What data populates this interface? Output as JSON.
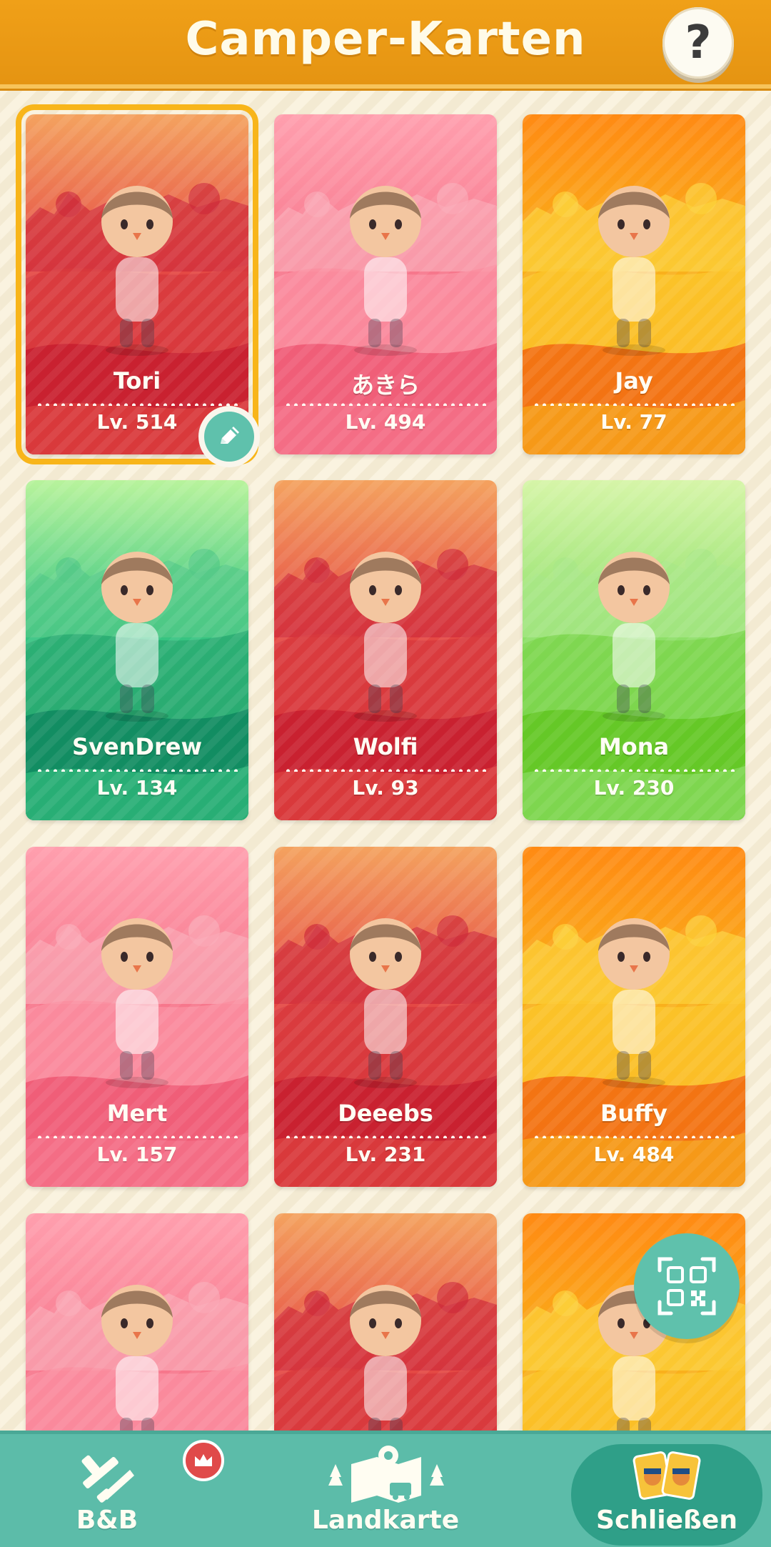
{
  "header": {
    "title": "Camper-Karten",
    "help_label": "?"
  },
  "cards": [
    {
      "name": "Tori",
      "level": "Lv. 514",
      "theme": "red",
      "selected": true
    },
    {
      "name": "あきら",
      "level": "Lv. 494",
      "theme": "pink",
      "selected": false
    },
    {
      "name": "Jay",
      "level": "Lv. 77",
      "theme": "orange",
      "selected": false
    },
    {
      "name": "SvenDrew",
      "level": "Lv. 134",
      "theme": "green",
      "selected": false
    },
    {
      "name": "Wolfi",
      "level": "Lv. 93",
      "theme": "red",
      "selected": false
    },
    {
      "name": "Mona",
      "level": "Lv. 230",
      "theme": "lime",
      "selected": false
    },
    {
      "name": "Mert",
      "level": "Lv. 157",
      "theme": "pink",
      "selected": false
    },
    {
      "name": "Deeebs",
      "level": "Lv. 231",
      "theme": "red",
      "selected": false
    },
    {
      "name": "Buffy",
      "level": "Lv. 484",
      "theme": "orange",
      "selected": false
    },
    {
      "name": "",
      "level": "",
      "theme": "pink",
      "selected": false
    },
    {
      "name": "",
      "level": "",
      "theme": "red",
      "selected": false
    },
    {
      "name": "",
      "level": "",
      "theme": "orange",
      "selected": false
    }
  ],
  "icons": {
    "edit": "pencil-icon",
    "qr": "qr-code-icon",
    "help": "question-mark-icon",
    "bnb": "hammer-saw-icon",
    "map": "map-icon",
    "close": "cards-icon",
    "crown": "crown-icon"
  },
  "bottom_nav": {
    "bnb_label": "B&B",
    "map_label": "Landkarte",
    "close_label": "Schließen"
  },
  "colors": {
    "header": "#e99a14",
    "accent_teal": "#5fc1ac",
    "selected_outline": "#f8b51a"
  }
}
